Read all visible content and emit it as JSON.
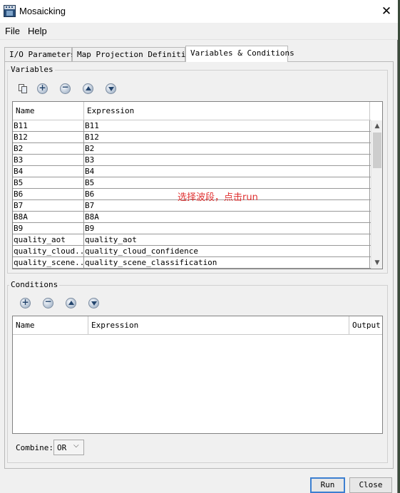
{
  "window": {
    "title": "Mosaicking",
    "close_symbol": "✕",
    "icon": "snap-app-icon"
  },
  "menu": [
    "File",
    "Help"
  ],
  "tabs": [
    {
      "label": "I/O Parameters",
      "active": false
    },
    {
      "label": "Map Projection Definition",
      "active": false
    },
    {
      "label": "Variables & Conditions",
      "active": true
    }
  ],
  "variables": {
    "title": "Variables",
    "toolbar_icons": [
      "copy-icon",
      "add-icon",
      "remove-icon",
      "move-up-icon",
      "move-down-icon"
    ],
    "columns": [
      "Name",
      "Expression"
    ],
    "rows": [
      [
        "B11",
        "B11"
      ],
      [
        "B12",
        "B12"
      ],
      [
        "B2",
        "B2"
      ],
      [
        "B3",
        "B3"
      ],
      [
        "B4",
        "B4"
      ],
      [
        "B5",
        "B5"
      ],
      [
        "B6",
        "B6"
      ],
      [
        "B7",
        "B7"
      ],
      [
        "B8A",
        "B8A"
      ],
      [
        "B9",
        "B9"
      ],
      [
        "quality_aot",
        "quality_aot"
      ],
      [
        "quality_cloud...",
        "quality_cloud_confidence"
      ],
      [
        "quality_scene...",
        "quality_scene_classification"
      ]
    ]
  },
  "annotation": "选择波段，点击run",
  "conditions": {
    "title": "Conditions",
    "toolbar_icons": [
      "add-icon",
      "remove-icon",
      "move-up-icon",
      "move-down-icon"
    ],
    "columns": [
      "Name",
      "Expression",
      "Output"
    ]
  },
  "combine": {
    "label": "Combine:",
    "value": "OR"
  },
  "buttons": {
    "run": "Run",
    "close": "Close"
  },
  "colors": {
    "annotation": "#e03030",
    "accent": "#3c7fd0"
  }
}
